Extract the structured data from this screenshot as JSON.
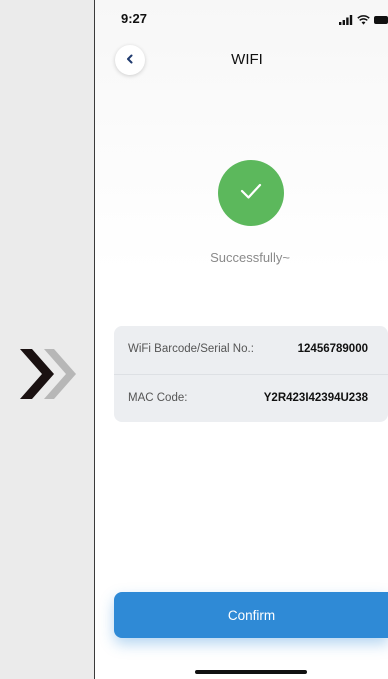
{
  "status_bar": {
    "time": "9:27",
    "icons": [
      "signal-icon",
      "wifi-icon",
      "battery-icon"
    ]
  },
  "header": {
    "title": "WIFI",
    "back_icon": "chevron-left-icon"
  },
  "result": {
    "icon": "checkmark-icon",
    "message": "Successfully~",
    "color": "#5cb85c"
  },
  "info": {
    "rows": [
      {
        "label": "WiFi Barcode/Serial No.:",
        "value": "12456789000"
      },
      {
        "label": "MAC Code:",
        "value": "Y2R423I42394U238"
      }
    ]
  },
  "actions": {
    "confirm_label": "Confirm",
    "accent": "#2f8ad6"
  },
  "side_nav": {
    "icon": "double-chevron-right-icon"
  }
}
